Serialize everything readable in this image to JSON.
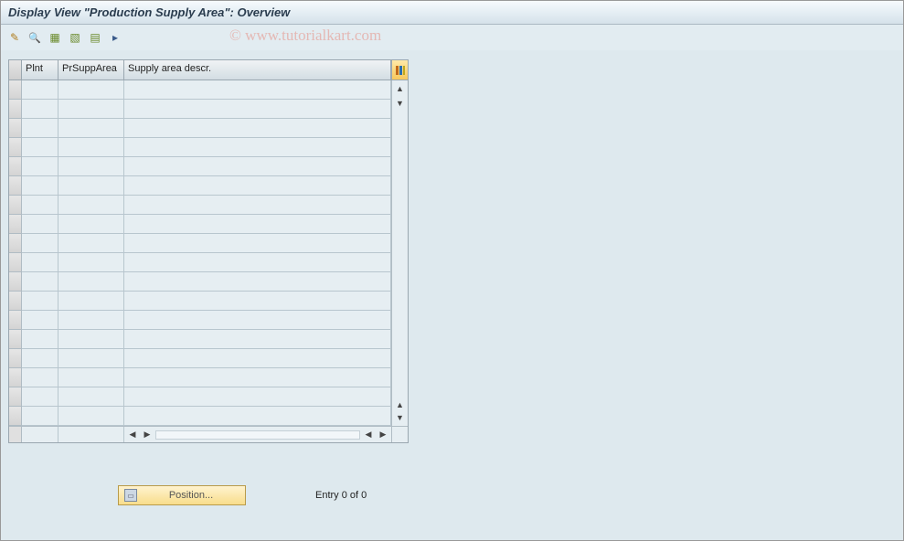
{
  "title": "Display View \"Production Supply Area\": Overview",
  "watermark": "© www.tutorialkart.com",
  "toolbar": {
    "icons": [
      "✎",
      "🔍",
      "▦",
      "▧",
      "▤",
      "▸"
    ]
  },
  "table": {
    "columns": {
      "plnt": "Plnt",
      "prSuppArea": "PrSuppArea",
      "supplyAreaDescr": "Supply area descr."
    },
    "rows": [
      "",
      "",
      "",
      "",
      "",
      "",
      "",
      "",
      "",
      "",
      "",
      "",
      "",
      "",
      "",
      "",
      "",
      ""
    ]
  },
  "footer": {
    "positionLabel": "Position...",
    "entryText": "Entry 0 of 0"
  }
}
